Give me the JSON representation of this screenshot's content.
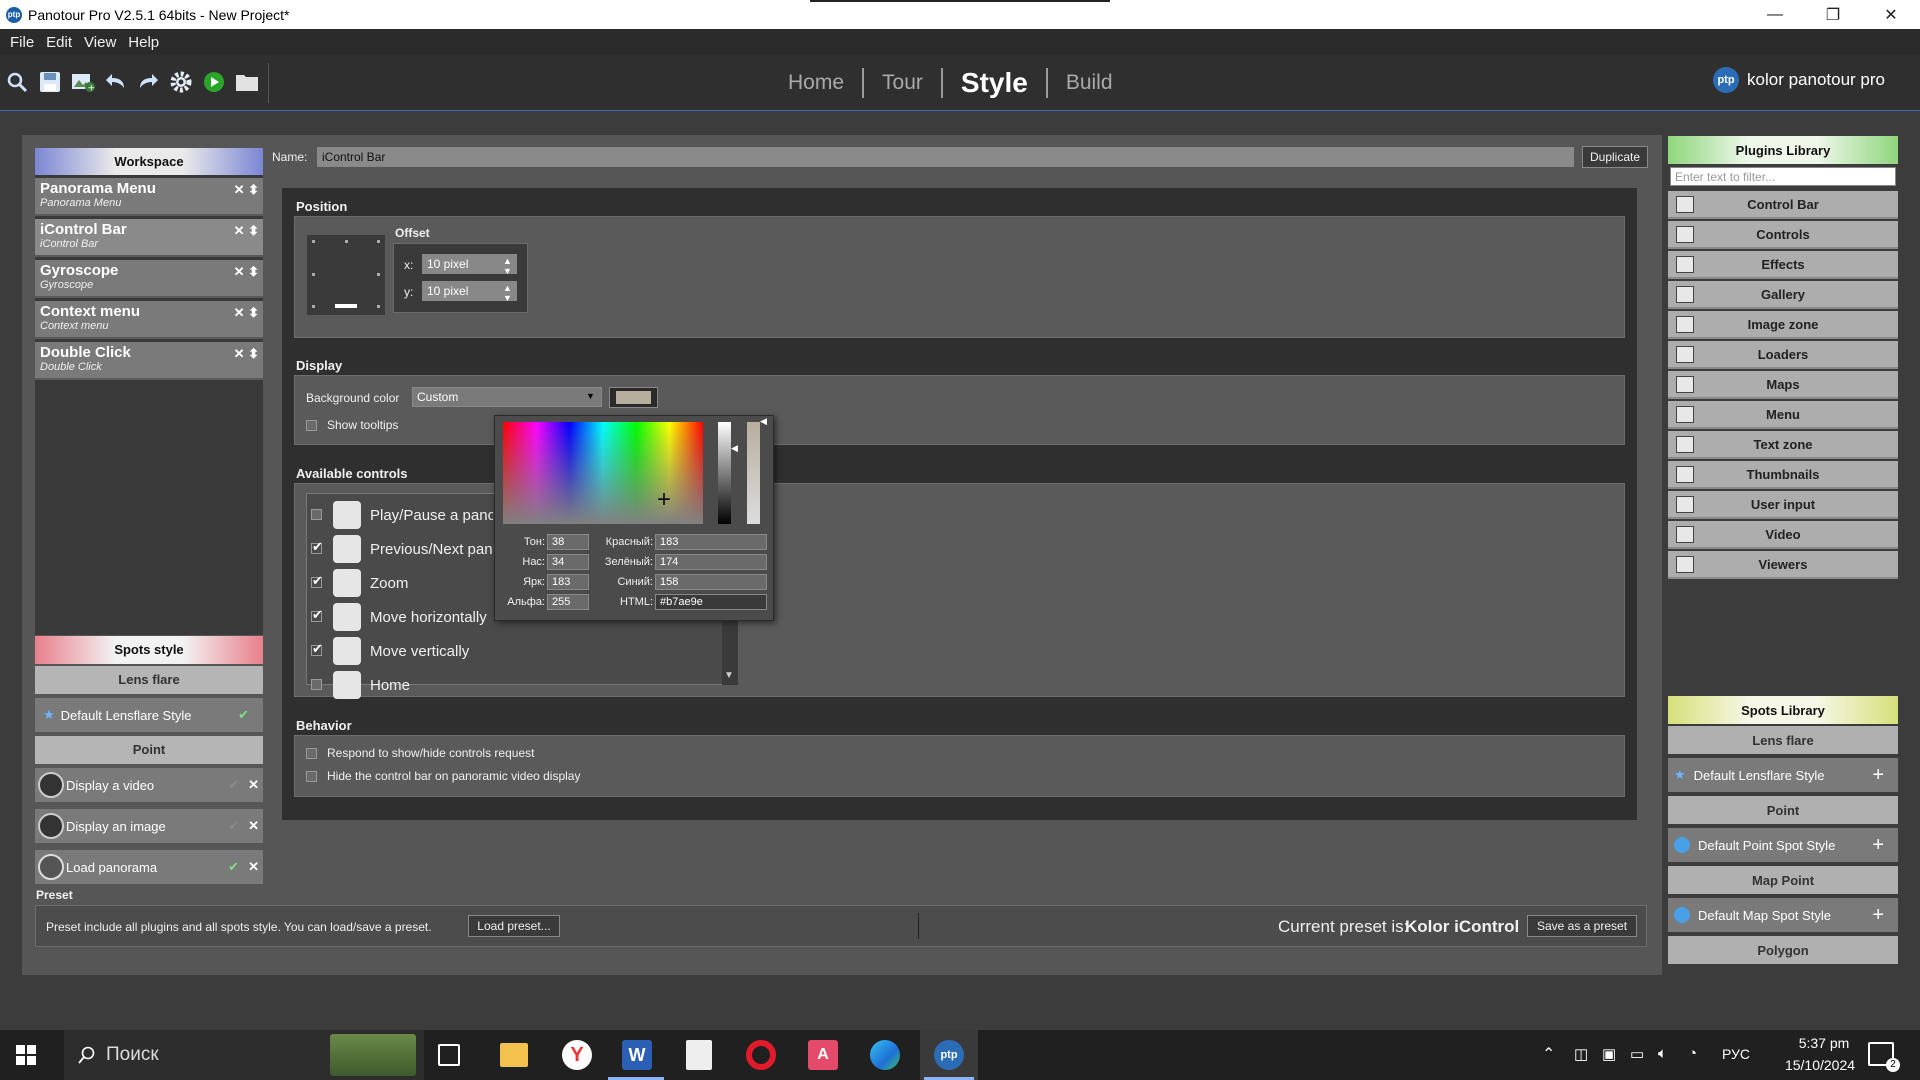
{
  "window": {
    "title": "Panotour Pro V2.5.1 64bits - New Project*",
    "controls": {
      "minimize": "—",
      "maximize": "❐",
      "close": "✕"
    }
  },
  "menu": [
    "File",
    "Edit",
    "View",
    "Help"
  ],
  "nav": {
    "tabs": [
      "Home",
      "Tour",
      "Style",
      "Build"
    ],
    "active": "Style"
  },
  "brand": {
    "logo": "ptp",
    "text": "kolor panotour pro"
  },
  "workspace": {
    "header": "Workspace",
    "items": [
      {
        "title": "Panorama Menu",
        "subtitle": "Panorama Menu"
      },
      {
        "title": "iControl Bar",
        "subtitle": "iControl Bar"
      },
      {
        "title": "Gyroscope",
        "subtitle": "Gyroscope"
      },
      {
        "title": "Context menu",
        "subtitle": "Context menu"
      },
      {
        "title": "Double Click",
        "subtitle": "Double Click"
      }
    ]
  },
  "spots_style": {
    "header": "Spots style",
    "lensflare_header": "Lens flare",
    "lensflare_item": "Default Lensflare Style",
    "point_header": "Point",
    "point_items": [
      "Display a video",
      "Display an image",
      "Load panorama"
    ]
  },
  "editor": {
    "name_label": "Name:",
    "name_value": "iControl Bar",
    "duplicate": "Duplicate",
    "position": {
      "title": "Position",
      "offset": "Offset",
      "x_label": "x:",
      "x_value": "10 pixel",
      "y_label": "y:",
      "y_value": "10 pixel"
    },
    "display": {
      "title": "Display",
      "bg_label": "Background color",
      "bg_value": "Custom",
      "show_tooltips": "Show tooltips",
      "swatch": "#b7ae9e"
    },
    "controls": {
      "title": "Available controls",
      "items": [
        {
          "label": "Play/Pause a panor",
          "checked": false
        },
        {
          "label": "Previous/Next pan",
          "checked": true
        },
        {
          "label": "Zoom",
          "checked": true
        },
        {
          "label": "Move horizontally",
          "checked": true
        },
        {
          "label": "Move vertically",
          "checked": true
        },
        {
          "label": "Home",
          "checked": false
        }
      ]
    },
    "behavior": {
      "title": "Behavior",
      "opt1": "Respond to show/hide controls request",
      "opt2": "Hide the control bar on panoramic video display"
    }
  },
  "color_picker": {
    "hue_label": "Тон:",
    "hue": "38",
    "sat_label": "Нас:",
    "sat": "34",
    "val_label": "Ярк:",
    "val": "183",
    "alpha_label": "Альфа:",
    "alpha": "255",
    "r_label": "Красный:",
    "r": "183",
    "g_label": "Зелёный:",
    "g": "174",
    "b_label": "Синий:",
    "b": "158",
    "html_label": "HTML:",
    "html": "#b7ae9e"
  },
  "preset": {
    "label": "Preset",
    "info": "Preset include all plugins and all spots style. You can load/save a preset.",
    "load": "Load preset...",
    "current_label": "Current preset is:",
    "current_value": "Kolor iControl",
    "save": "Save as a preset"
  },
  "plugins": {
    "header": "Plugins Library",
    "filter_placeholder": "Enter text to filter...",
    "items": [
      "Control Bar",
      "Controls",
      "Effects",
      "Gallery",
      "Image zone",
      "Loaders",
      "Maps",
      "Menu",
      "Text zone",
      "Thumbnails",
      "User input",
      "Video",
      "Viewers"
    ]
  },
  "spots_library": {
    "header": "Spots Library",
    "lensflare_header": "Lens flare",
    "lensflare_item": "Default Lensflare Style",
    "point_header": "Point",
    "point_item": "Default Point Spot Style",
    "mappoint_header": "Map Point",
    "mappoint_item": "Default Map Spot Style",
    "polygon_header": "Polygon"
  },
  "taskbar": {
    "search": "Поиск",
    "lang": "РУС",
    "time": "5:37 pm",
    "date": "15/10/2024",
    "notif": "2"
  }
}
